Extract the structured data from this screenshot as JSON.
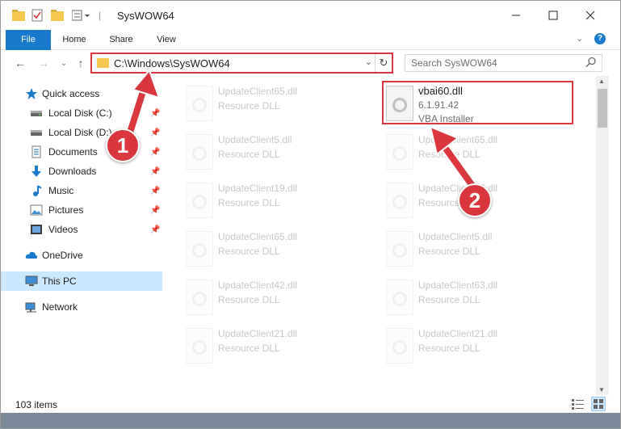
{
  "window": {
    "title": "SysWOW64"
  },
  "ribbon": {
    "tabs": [
      {
        "label": "File"
      },
      {
        "label": "Home"
      },
      {
        "label": "Share"
      },
      {
        "label": "View"
      }
    ]
  },
  "address": {
    "path": "C:\\Windows\\SysWOW64"
  },
  "search": {
    "placeholder": "Search SysWOW64"
  },
  "nav": {
    "items": [
      {
        "label": "Quick access",
        "icon": "star-icon"
      },
      {
        "label": "Local Disk (C:)",
        "icon": "drive-icon",
        "pinned": true
      },
      {
        "label": "Local Disk (D:)",
        "icon": "drive-icon",
        "pinned": true
      },
      {
        "label": "Documents",
        "icon": "documents-icon",
        "pinned": true
      },
      {
        "label": "Downloads",
        "icon": "download-arrow-icon",
        "pinned": true
      },
      {
        "label": "Music",
        "icon": "music-note-icon",
        "pinned": true
      },
      {
        "label": "Pictures",
        "icon": "pictures-icon",
        "pinned": true
      },
      {
        "label": "Videos",
        "icon": "videos-icon",
        "pinned": true
      },
      {
        "label": "OneDrive",
        "icon": "cloud-icon"
      },
      {
        "label": "This PC",
        "icon": "monitor-icon",
        "selected": true
      },
      {
        "label": "Network",
        "icon": "network-icon"
      }
    ]
  },
  "files": {
    "left": [
      {
        "name": "UpdateClient65.dll",
        "type": "Resource DLL"
      },
      {
        "name": "UpdateClient5.dll",
        "type": "Resource DLL"
      },
      {
        "name": "UpdateClient19.dll",
        "type": "Resource DLL"
      },
      {
        "name": "UpdateClient65.dll",
        "type": "Resource DLL"
      },
      {
        "name": "UpdateClient42.dll",
        "type": "Resource DLL"
      },
      {
        "name": "UpdateClient21.dll",
        "type": "Resource DLL"
      }
    ],
    "right": [
      {
        "name": "UpdateClient65.dll",
        "type": "Resource DLL"
      },
      {
        "name": "UpdateClient15.dll",
        "type": "Resource DLL"
      },
      {
        "name": "UpdateClient5.dll",
        "type": "Resource DLL"
      },
      {
        "name": "UpdateClient63.dll",
        "type": "Resource DLL"
      },
      {
        "name": "UpdateClient21.dll",
        "type": "Resource DLL"
      }
    ],
    "highlighted": {
      "name": "vbai60.dll",
      "version": "6.1.91.42",
      "description": "VBA Installer"
    }
  },
  "status": {
    "count": "103 items"
  },
  "annotations": {
    "step1": "1",
    "step2": "2"
  },
  "colors": {
    "accent": "#1979ca",
    "highlight": "#d9363e",
    "selection": "#cce8ff"
  }
}
